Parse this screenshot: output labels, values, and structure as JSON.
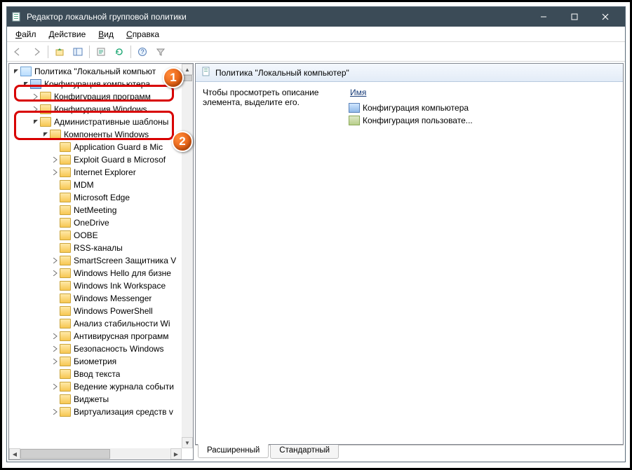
{
  "title": "Редактор локальной групповой политики",
  "menu": {
    "file": "Файл",
    "action": "Действие",
    "view": "Вид",
    "help": "Справка"
  },
  "tree": {
    "root": "Политика \"Локальный компьют",
    "comp_config": "Конфигурация компьютера",
    "prog_config": "Конфигурация программ",
    "win_config": "Конфигурация Windows",
    "admin_templates": "Административные шаблоны",
    "win_components": "Компоненты Windows",
    "items": [
      "Application Guard в Mic",
      "Exploit Guard в Microsof",
      "Internet Explorer",
      "MDM",
      "Microsoft Edge",
      "NetMeeting",
      "OneDrive",
      "OOBE",
      "RSS-каналы",
      "SmartScreen Защитника V",
      "Windows Hello для бизне",
      "Windows Ink Workspace",
      "Windows Messenger",
      "Windows PowerShell",
      "Анализ стабильности Wi",
      "Антивирусная программ",
      "Безопасность Windows",
      "Биометрия",
      "Ввод текста",
      "Ведение журнала событи",
      "Виджеты",
      "Виртуализация средств v"
    ],
    "item_expand": [
      "",
      "r",
      "r",
      "",
      "",
      "",
      "",
      "",
      "",
      "r",
      "r",
      "",
      "",
      "",
      "",
      "r",
      "r",
      "r",
      "",
      "r",
      "",
      "r"
    ]
  },
  "right": {
    "header": "Политика \"Локальный компьютер\"",
    "desc": "Чтобы просмотреть описание элемента, выделите его.",
    "col_name": "Имя",
    "row1": "Конфигурация компьютера",
    "row2": "Конфигурация пользовате..."
  },
  "tabs": {
    "ext": "Расширенный",
    "std": "Стандартный"
  },
  "badges": {
    "b1": "1",
    "b2": "2"
  }
}
